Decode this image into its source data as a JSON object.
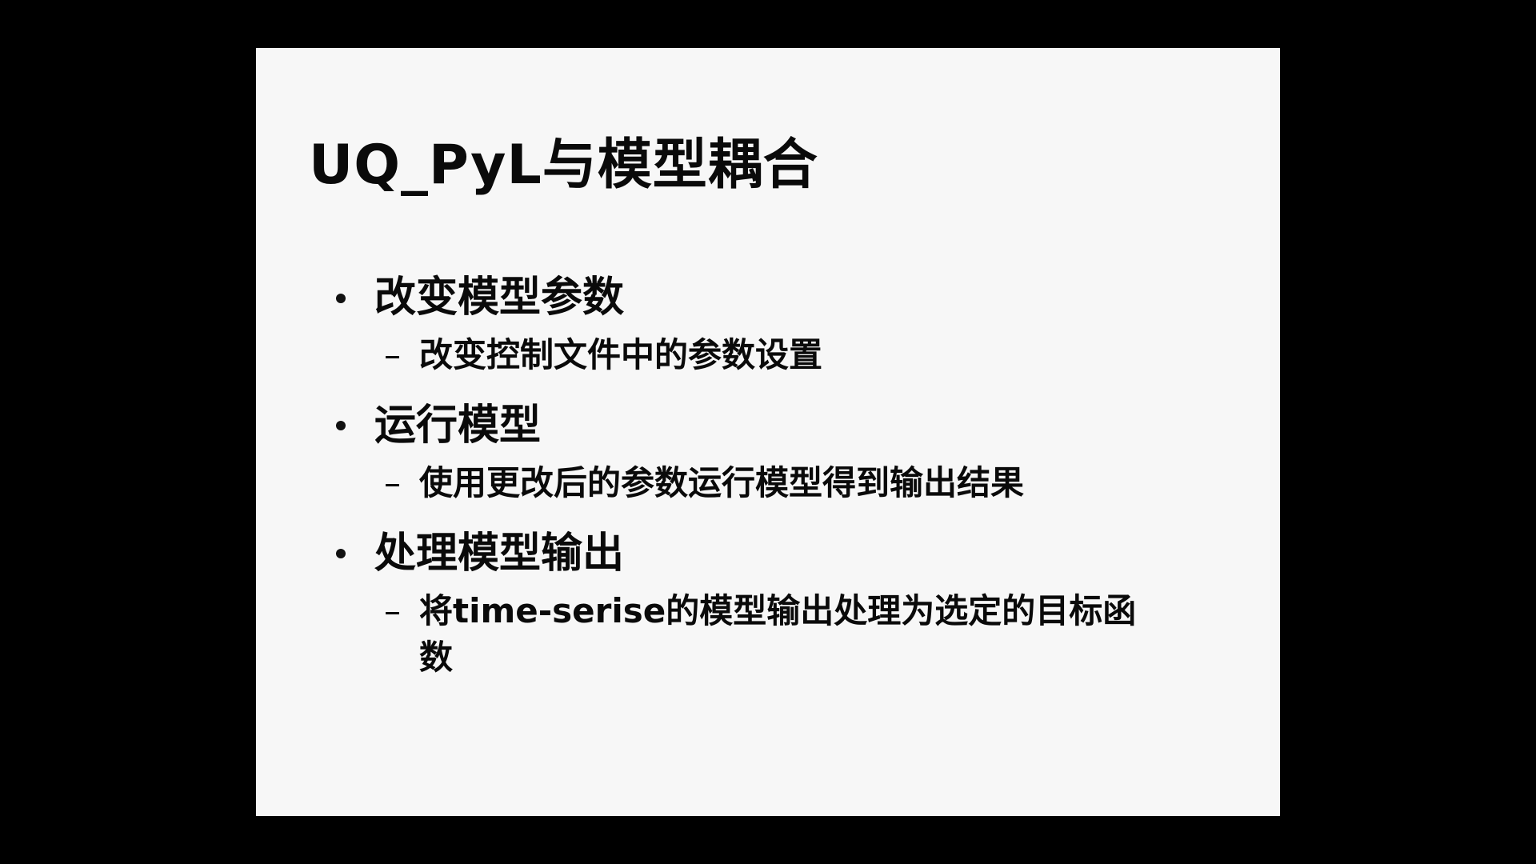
{
  "slide": {
    "title": "UQ_PyL与模型耦合",
    "bullets": [
      {
        "text": "改变模型参数",
        "sub": {
          "dash": "–",
          "text": "改变控制文件中的参数设置"
        }
      },
      {
        "text": "运行模型",
        "sub": {
          "dash": "–",
          "text": "使用更改后的参数运行模型得到输出结果"
        }
      },
      {
        "text": "处理模型输出",
        "sub": {
          "dash": "–",
          "text": "将time-serise的模型输出处理为选定的目标函数"
        }
      }
    ]
  },
  "colors": {
    "background": "#000000",
    "slide": "#f7f7f7",
    "text": "#0a0a0a"
  }
}
